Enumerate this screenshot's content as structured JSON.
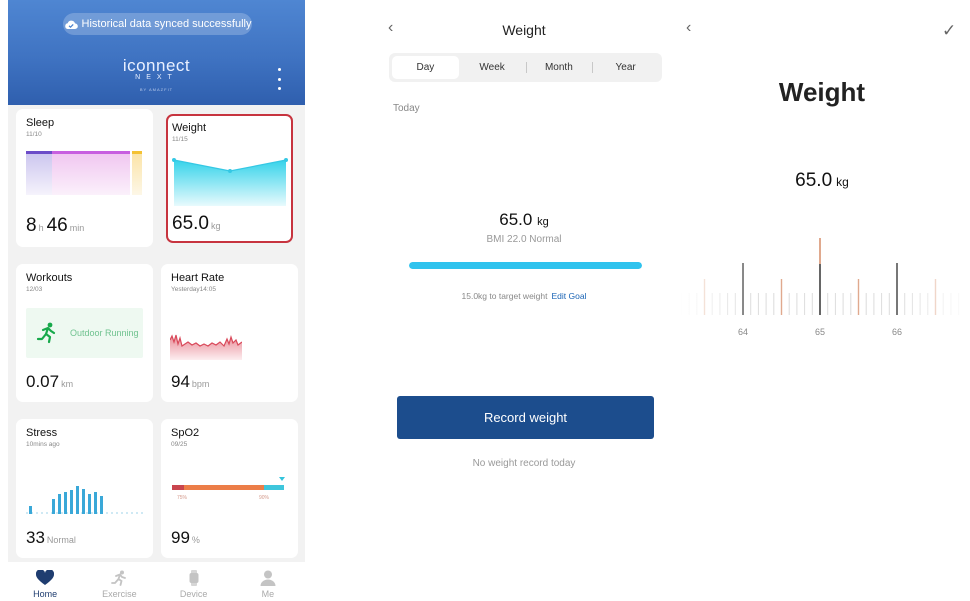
{
  "dashboard": {
    "sync_banner": "Historical data synced successfully",
    "logo": {
      "main": "iconnect",
      "sub": "NEXT",
      "tiny": "BY AMAZFIT"
    },
    "cards": {
      "sleep": {
        "title": "Sleep",
        "date": "11/10",
        "hours": "8",
        "hours_unit": "h",
        "minutes": "46",
        "minutes_unit": "min"
      },
      "weight": {
        "title": "Weight",
        "date": "11/15",
        "value": "65.0",
        "unit": "kg"
      },
      "workouts": {
        "title": "Workouts",
        "date": "12/03",
        "activity": "Outdoor Running",
        "value": "0.07",
        "unit": "km"
      },
      "heart": {
        "title": "Heart Rate",
        "date": "Yesterday14:05",
        "value": "94",
        "unit": "bpm"
      },
      "stress": {
        "title": "Stress",
        "date": "10mins ago",
        "value": "33",
        "unit": "Normal"
      },
      "spo2": {
        "title": "SpO2",
        "date": "09/25",
        "value": "99",
        "unit": "%",
        "tick_low": "75%",
        "tick_high": "90%"
      }
    },
    "nav": [
      {
        "label": "Home",
        "icon": "heart-icon",
        "active": true
      },
      {
        "label": "Exercise",
        "icon": "running-icon",
        "active": false
      },
      {
        "label": "Device",
        "icon": "watch-icon",
        "active": false
      },
      {
        "label": "Me",
        "icon": "person-icon",
        "active": false
      }
    ]
  },
  "weight_day": {
    "title": "Weight",
    "tabs": [
      "Day",
      "Week",
      "Month",
      "Year"
    ],
    "selected_tab": "Day",
    "period_label": "Today",
    "value": "65.0",
    "unit": "kg",
    "bmi": "BMI 22.0 Normal",
    "target_text": "15.0kg to target weight",
    "edit_goal": "Edit Goal",
    "record_button": "Record weight",
    "no_record": "No weight record today"
  },
  "weight_picker": {
    "title": "Weight",
    "value": "65.0",
    "unit": "kg",
    "ruler_labels": [
      "64",
      "65",
      "66"
    ],
    "selected": 65.0
  },
  "colors": {
    "header_blue": "#3f73c2",
    "selected_border": "#c7343f",
    "weight_area": "#35d3ea",
    "heart_red": "#d9495a",
    "stress_blue": "#3aa8d8",
    "progress_cyan": "#2fc3ee",
    "button_navy": "#1c4d8d",
    "link_blue": "#1a64b5",
    "ruler_accent": "#e0a98e"
  }
}
